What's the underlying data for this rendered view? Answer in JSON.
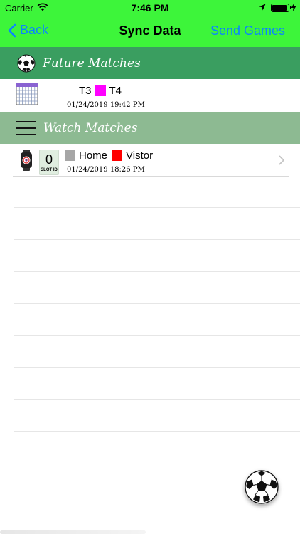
{
  "status_bar": {
    "carrier": "Carrier",
    "time": "7:46 PM"
  },
  "nav": {
    "back_label": "Back",
    "title": "Sync Data",
    "right_label": "Send Games"
  },
  "future_section": {
    "title": "Future Matches",
    "rows": [
      {
        "team1": "T3",
        "team1_color": "#ff00ff",
        "team2": "T4",
        "date": "01/24/2019 19:42 PM"
      }
    ]
  },
  "watch_section": {
    "title": "Watch Matches",
    "rows": [
      {
        "slot_number": "0",
        "slot_label": "SLOT ID",
        "team1": "Home",
        "team1_color": "#a6a6a6",
        "team2": "Vistor",
        "team2_color": "#ff0000",
        "date": "01/24/2019 18:26 PM"
      }
    ]
  },
  "colors": {
    "nav_background": "#3df53a",
    "future_header": "#3a9e60",
    "watch_header": "#8dba92",
    "accent": "#0a84ff"
  },
  "icons": {
    "future_header": "soccer-ball-icon",
    "watch_header": "menu-icon",
    "future_row": "calendar-icon",
    "watch_row": "watch-icon",
    "fab": "soccer-ball-icon"
  }
}
